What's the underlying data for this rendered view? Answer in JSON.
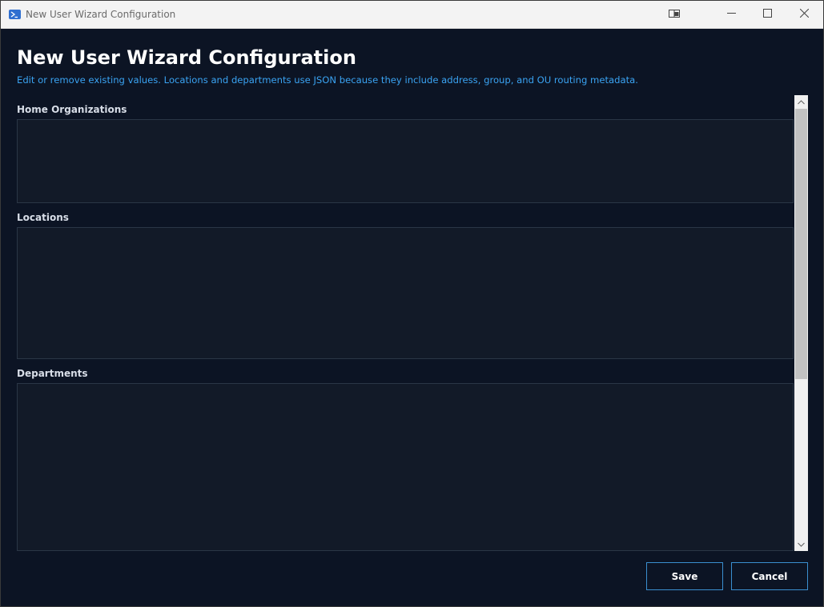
{
  "window": {
    "title": "New User Wizard Configuration",
    "controls": {
      "snap_icon": "snap-layout-icon",
      "minimize_icon": "minimize-icon",
      "maximize_icon": "maximize-icon",
      "close_icon": "close-icon"
    }
  },
  "main": {
    "heading": "New User Wizard Configuration",
    "subheading": "Edit or remove existing values. Locations and departments use JSON because they include address, group, and OU routing metadata.",
    "fields": [
      {
        "label": "Home Organizations",
        "value": ""
      },
      {
        "label": "Locations",
        "value": ""
      },
      {
        "label": "Departments",
        "value": ""
      }
    ]
  },
  "buttons": {
    "save_label": "Save",
    "cancel_label": "Cancel"
  },
  "colors": {
    "background": "#0c1424",
    "accent": "#3aa3f2",
    "button_border": "#3a8fd0"
  }
}
